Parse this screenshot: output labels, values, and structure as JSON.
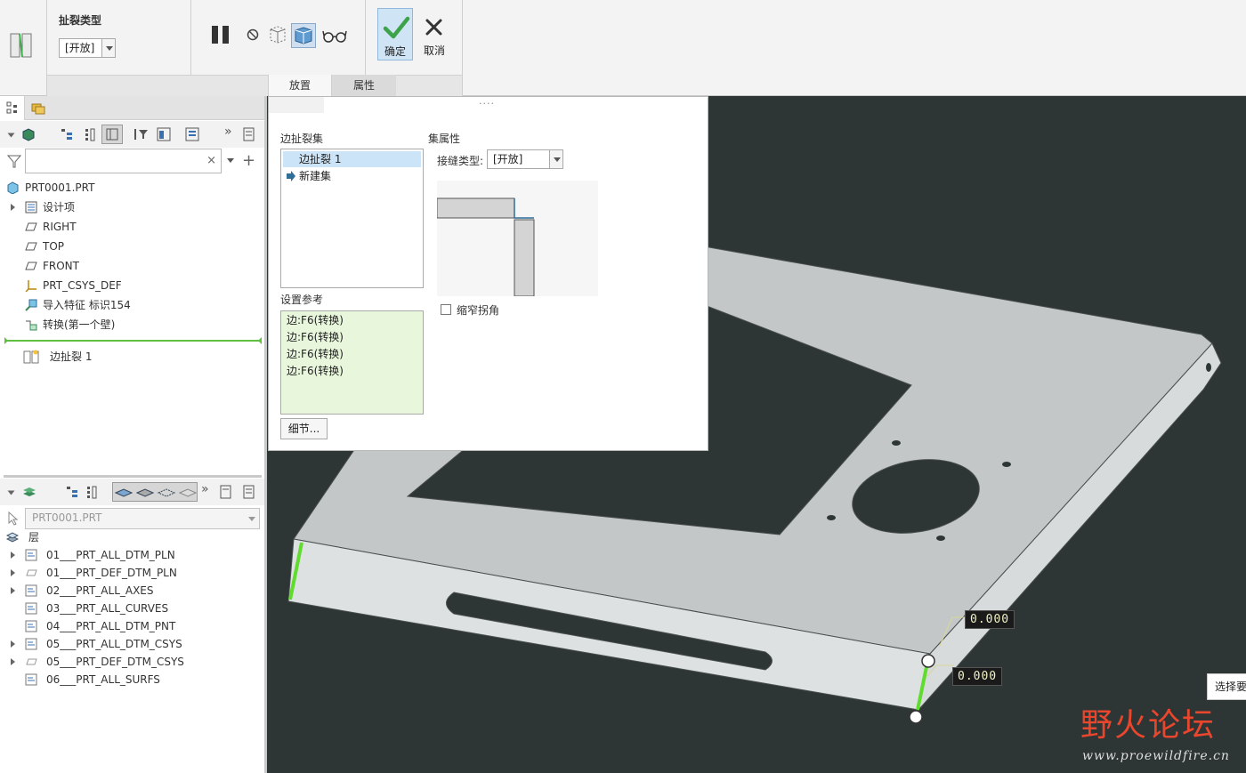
{
  "ribbon": {
    "rip_type_label": "扯裂类型",
    "rip_type_value": "[开放]",
    "ok_label": "确定",
    "cancel_label": "取消",
    "tabs": [
      {
        "label": "放置",
        "active": true
      },
      {
        "label": "属性",
        "active": false
      }
    ]
  },
  "model_tree": {
    "root": "PRT0001.PRT",
    "items": [
      {
        "label": "设计项",
        "icon": "design-items-icon"
      },
      {
        "label": "RIGHT",
        "icon": "datum-plane-icon"
      },
      {
        "label": "TOP",
        "icon": "datum-plane-icon"
      },
      {
        "label": "FRONT",
        "icon": "datum-plane-icon"
      },
      {
        "label": "PRT_CSYS_DEF",
        "icon": "csys-icon"
      },
      {
        "label": "导入特征 标识154",
        "icon": "import-feature-icon"
      },
      {
        "label": "转换(第一个壁)",
        "icon": "convert-icon"
      }
    ],
    "inserted_item": "边扯裂 1"
  },
  "layer_tree": {
    "selector_value": "PRT0001.PRT",
    "root": "层",
    "items": [
      "01___PRT_ALL_DTM_PLN",
      "01___PRT_DEF_DTM_PLN",
      "02___PRT_ALL_AXES",
      "03___PRT_ALL_CURVES",
      "04___PRT_ALL_DTM_PNT",
      "05___PRT_ALL_DTM_CSYS",
      "05___PRT_DEF_DTM_CSYS",
      "06___PRT_ALL_SURFS"
    ]
  },
  "panel": {
    "grip": "....",
    "edge_rip_set_label": "边扯裂集",
    "sets": [
      "边扯裂 1"
    ],
    "new_set": "新建集",
    "set_properties_label": "集属性",
    "seam_type_label": "接缝类型:",
    "seam_type_value": "[开放]",
    "shrink_corner_label": "缩窄拐角",
    "shrink_corner_checked": false,
    "references_label": "设置参考",
    "references": [
      "边:F6(转换)",
      "边:F6(转换)",
      "边:F6(转换)",
      "边:F6(转换)"
    ],
    "details_button": "细节..."
  },
  "viewport": {
    "dimensions": [
      "0.000",
      "0.000"
    ],
    "tooltip": "选择要"
  },
  "watermark": {
    "cn": "野火论坛",
    "url": "www.proewildfire.cn"
  },
  "colors": {
    "viewport_bg": "#2e3535",
    "highlight_edge": "#5fdc2e",
    "selection": "#cce4f7",
    "references_bg": "#e8f7dc"
  }
}
